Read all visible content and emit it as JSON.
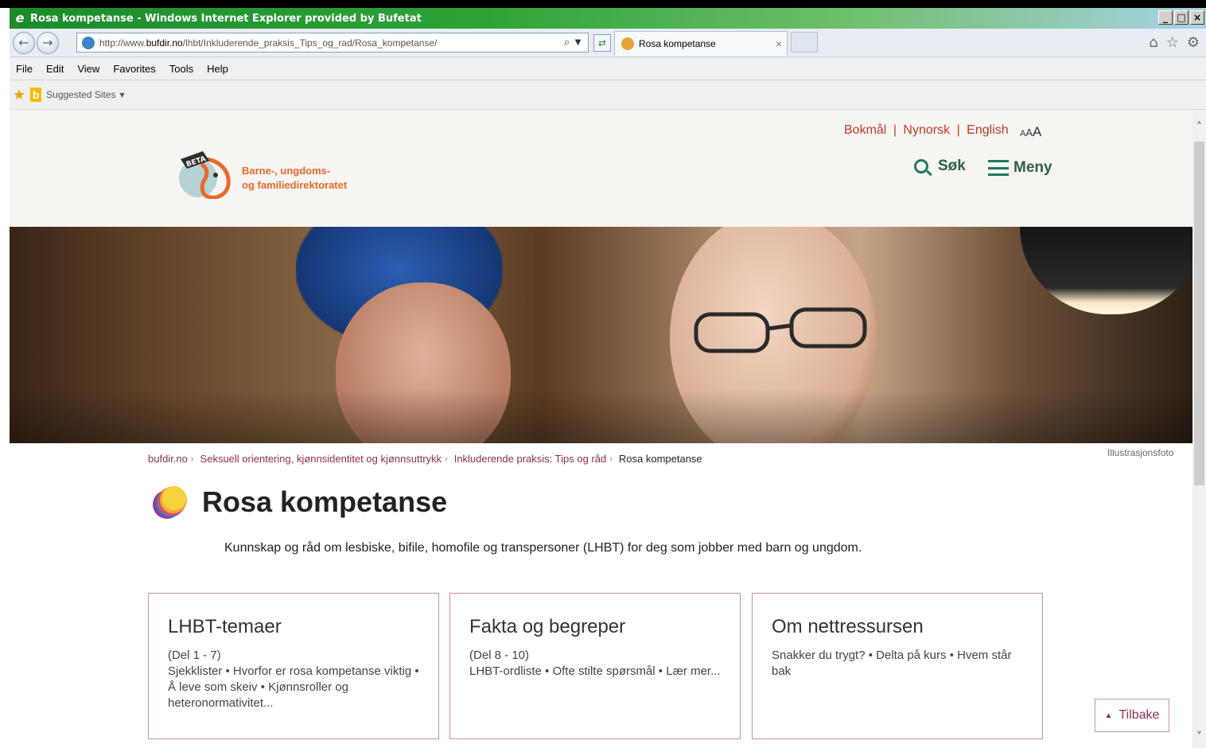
{
  "window": {
    "title": "Rosa kompetanse - Windows Internet Explorer provided by Bufetat",
    "controls": [
      "_",
      "□",
      "×"
    ]
  },
  "browser": {
    "back_icon": "back-arrow-icon",
    "forward_icon": "forward-arrow-icon",
    "address_prefix": "http://www.",
    "address_domain": "bufdir.no",
    "address_path": "/lhbt/Inkluderende_praksis_Tips_og_rad/Rosa_kompetanse/",
    "search_icon": "⌕",
    "dropdown_icon": "▼",
    "refresh_icon": "⇄",
    "tab_label": "Rosa kompetanse",
    "tab_close": "×"
  },
  "menubar": {
    "items": [
      "File",
      "Edit",
      "View",
      "Favorites",
      "Tools",
      "Help"
    ]
  },
  "favorites": {
    "suggested_sites": "Suggested Sites",
    "dropdown": "▾",
    "bing_letter": "b"
  },
  "site": {
    "languages": [
      "Bokmål",
      "Nynorsk",
      "English"
    ],
    "lang_separator": "|",
    "fontsize": {
      "small": "A",
      "medium": "A",
      "large": "A"
    },
    "logo_badge": "BETA",
    "logo_line1": "Barne-, ungdoms-",
    "logo_line2": "og familiedirektoratet",
    "search_label": "Søk",
    "menu_label": "Meny",
    "photo_credit": "Illustrasjonsfoto",
    "breadcrumb": [
      "bufdir.no",
      "Seksuell orientering, kjønnsidentitet og kjønnsuttrykk",
      "Inkluderende praksis: Tips og råd"
    ],
    "breadcrumb_sep": "›",
    "breadcrumb_current": "Rosa kompetanse",
    "page_title": "Rosa kompetanse",
    "intro": "Kunnskap og råd om lesbiske, bifile, homofile og transpersoner (LHBT) for deg som jobber med barn og ungdom.",
    "cards": [
      {
        "title": "LHBT-temaer",
        "range": "(Del 1 - 7)",
        "text": "Sjekklister • Hvorfor er rosa kompetanse viktig • Å leve som skeiv • Kjønnsroller og heteronormativitet..."
      },
      {
        "title": "Fakta og begreper",
        "range": "(Del 8 - 10)",
        "text": "LHBT-ordliste • Ofte stilte spørsmål • Lær mer..."
      },
      {
        "title": "Om nettressursen",
        "range": "",
        "text": "Snakker du trygt? •  Delta på kurs • Hvem står bak"
      }
    ],
    "back_label": "Tilbake",
    "back_icon": "▲"
  },
  "scrollbar": {
    "up": "˄",
    "down": "˅"
  },
  "colors": {
    "accent": "#c0392b",
    "brand_orange": "#e8692b",
    "link": "#8b2f55",
    "card_border": "#c98fa5",
    "nav_green": "#2f5f4a"
  }
}
